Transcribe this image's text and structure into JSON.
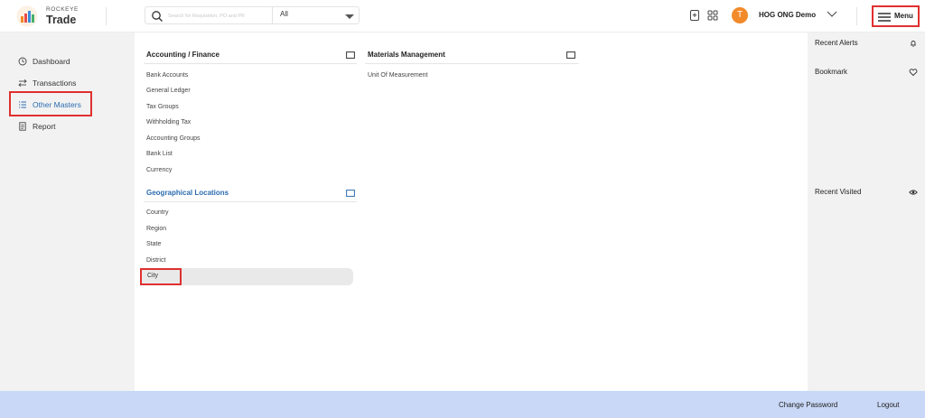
{
  "app": {
    "logo_top": "ROCKEYE",
    "logo_bottom": "Trade"
  },
  "search": {
    "placeholder": "Search for Requisition, PO and PR",
    "scope": "All"
  },
  "header": {
    "user_initial": "T",
    "user_name": "HOG ONG Demo",
    "menu_label": "Menu"
  },
  "sidebar": {
    "items": [
      {
        "label": "Dashboard",
        "icon": "clock-icon"
      },
      {
        "label": "Transactions",
        "icon": "swap-icon"
      },
      {
        "label": "Other Masters",
        "icon": "list-icon",
        "active": true
      },
      {
        "label": "Report",
        "icon": "document-icon"
      }
    ]
  },
  "main": {
    "accounting": {
      "title": "Accounting / Finance",
      "links": [
        "Bank Accounts",
        "General Ledger",
        "Tax Groups",
        "Withholding Tax",
        "Accounting Groups",
        "Bank List",
        "Currency"
      ]
    },
    "geo": {
      "title": "Geographical Locations",
      "links": [
        "Country",
        "Region",
        "State",
        "District",
        "City"
      ]
    },
    "materials": {
      "title": "Materials Management",
      "links": [
        "Unit Of Measurement"
      ]
    }
  },
  "right_panel": {
    "recent_alerts": "Recent Alerts",
    "bookmark": "Bookmark",
    "recent_visited": "Recent Visited"
  },
  "footer": {
    "change_password": "Change Password",
    "logout": "Logout"
  },
  "colors": {
    "accent_blue": "#2b6cb0",
    "highlight_red": "#e03030",
    "footer_bg": "#c9d8f7",
    "avatar": "#f28a2a"
  }
}
